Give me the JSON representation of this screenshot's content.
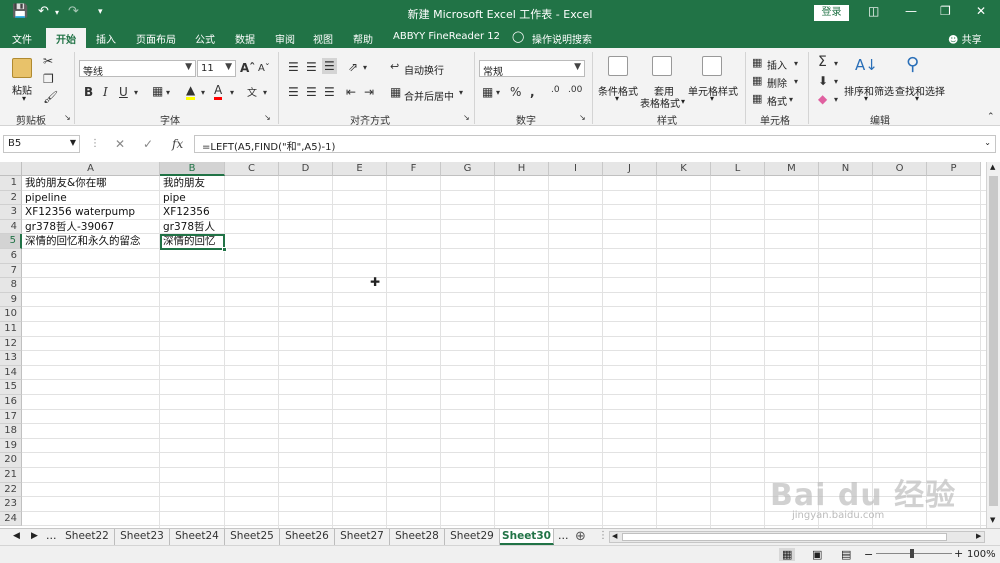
{
  "titlebar": {
    "title": "新建 Microsoft Excel 工作表 - Excel",
    "login": "登录"
  },
  "tabs": [
    "文件",
    "开始",
    "插入",
    "页面布局",
    "公式",
    "数据",
    "审阅",
    "视图",
    "帮助",
    "ABBYY FineReader 12",
    "操作说明搜索"
  ],
  "share": "共享",
  "ribbon": {
    "paste": "粘贴",
    "clipboard": "剪贴板",
    "font_name": "等线",
    "font_size": "11",
    "font_group": "字体",
    "wrap_text": "自动换行",
    "merge_center": "合并后居中",
    "align_group": "对齐方式",
    "number_format": "常规",
    "number_group": "数字",
    "cond_format": "条件格式",
    "table_format_1": "套用",
    "table_format_2": "表格格式",
    "cell_style": "单元格样式",
    "style_group": "样式",
    "insert": "插入",
    "delete": "删除",
    "format": "格式",
    "cells_group": "单元格",
    "sort_filter": "排序和筛选",
    "find_select": "查找和选择",
    "edit_group": "编辑"
  },
  "formula_bar": {
    "name_box": "B5",
    "formula": "=LEFT(A5,FIND(\"和\",A5)-1)"
  },
  "columns": [
    "A",
    "B",
    "C",
    "D",
    "E",
    "F",
    "G",
    "H",
    "I",
    "J",
    "K",
    "L",
    "M",
    "N",
    "O",
    "P"
  ],
  "rows": [
    "1",
    "2",
    "3",
    "4",
    "5",
    "6",
    "7",
    "8",
    "9",
    "10",
    "11",
    "12",
    "13",
    "14",
    "15",
    "16",
    "17",
    "18",
    "19",
    "20",
    "21",
    "22",
    "23",
    "24"
  ],
  "cells": {
    "A1": "我的朋友&你在哪",
    "B1": "我的朋友",
    "A2": "pipeline",
    "B2": "pipe",
    "A3": "XF12356 waterpump",
    "B3": "XF12356",
    "A4": "gr378哲人-39067",
    "B4": "gr378哲人",
    "A5": "深情的回忆和永久的留念",
    "B5": "深情的回忆"
  },
  "sheets": [
    "Sheet22",
    "Sheet23",
    "Sheet24",
    "Sheet25",
    "Sheet26",
    "Sheet27",
    "Sheet28",
    "Sheet29",
    "Sheet30"
  ],
  "active_sheet": "Sheet30",
  "status": {
    "zoom": "100%"
  },
  "watermark": {
    "brand": "Bai du 经验",
    "url": "jingyan.baidu.com"
  },
  "colors": {
    "accent": "#217346"
  }
}
